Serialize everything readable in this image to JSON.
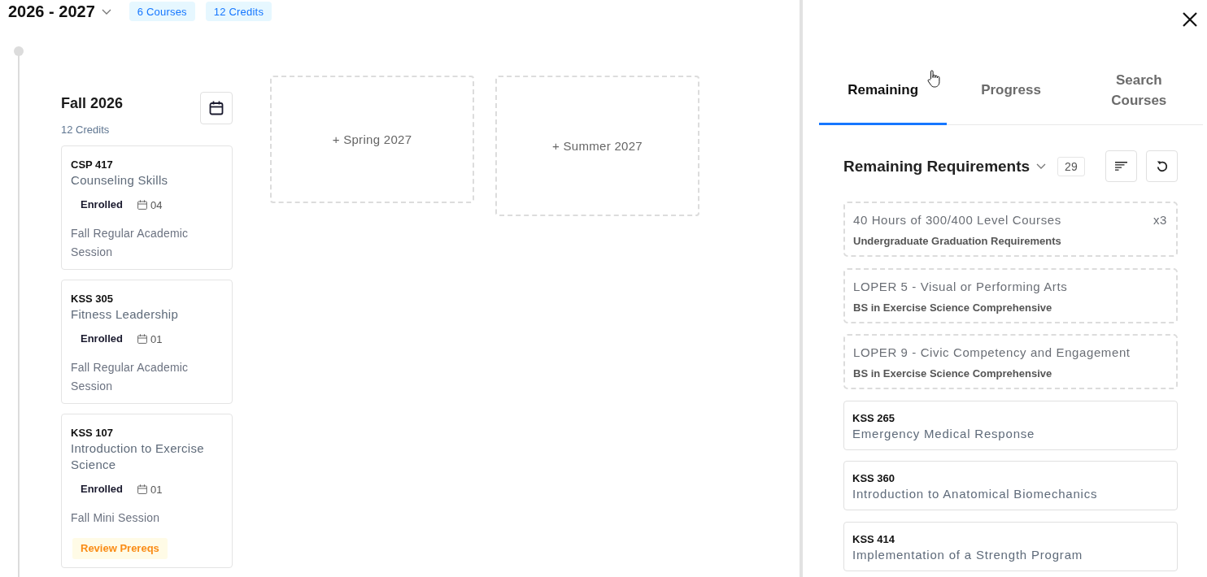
{
  "year_header": {
    "title": "2026 - 2027",
    "badges": [
      "6 Courses",
      "12 Credits"
    ]
  },
  "terms": [
    {
      "kind": "term",
      "name": "Fall 2026",
      "credits": "12 Credits",
      "courses": [
        {
          "code": "CSP 417",
          "title": "Counseling Skills",
          "status": "Enrolled",
          "section": "04",
          "session": "Fall Regular Academic Session"
        },
        {
          "code": "KSS 305",
          "title": "Fitness Leadership",
          "status": "Enrolled",
          "section": "01",
          "session": "Fall Regular Academic Session"
        },
        {
          "code": "KSS 107",
          "title": "Introduction to Exercise Science",
          "status": "Enrolled",
          "section": "01",
          "session": "Fall Mini Session",
          "warning": "Review Prereqs"
        }
      ]
    },
    {
      "kind": "add",
      "label": "+ Spring 2027"
    },
    {
      "kind": "add",
      "label": "+ Summer 2027"
    }
  ],
  "panel": {
    "tabs": [
      {
        "label": "Remaining",
        "selected": true
      },
      {
        "label": "Progress",
        "selected": false
      },
      {
        "label": "Search Courses",
        "selected": false
      }
    ],
    "heading": "Remaining Requirements",
    "count": "29",
    "requirements": [
      {
        "kind": "requirement",
        "title": "40 Hours of 300/400 Level Courses",
        "source": "Undergraduate Graduation Requirements",
        "multiplier": "x3"
      },
      {
        "kind": "requirement",
        "title": "LOPER 5 - Visual or Performing Arts",
        "source": "BS in Exercise Science Comprehensive"
      },
      {
        "kind": "requirement",
        "title": "LOPER 9 - Civic Competency and Engagement",
        "source": "BS in Exercise Science Comprehensive"
      },
      {
        "kind": "course",
        "code": "KSS 265",
        "title": "Emergency Medical Response"
      },
      {
        "kind": "course",
        "code": "KSS 360",
        "title": "Introduction to Anatomical Biomechanics"
      },
      {
        "kind": "course",
        "code": "KSS 414",
        "title": "Implementation of a Strength Program"
      }
    ]
  }
}
